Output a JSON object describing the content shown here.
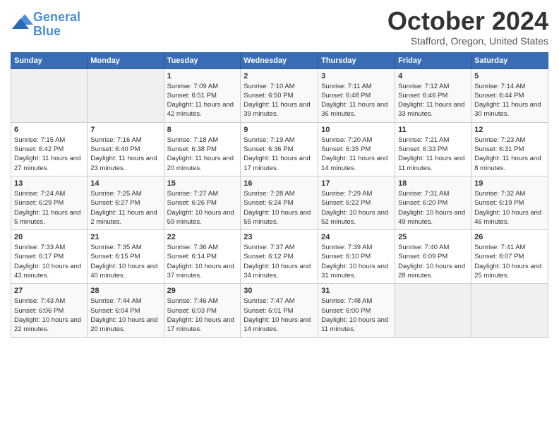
{
  "header": {
    "logo_line1": "General",
    "logo_line2": "Blue",
    "month_title": "October 2024",
    "location": "Stafford, Oregon, United States"
  },
  "weekdays": [
    "Sunday",
    "Monday",
    "Tuesday",
    "Wednesday",
    "Thursday",
    "Friday",
    "Saturday"
  ],
  "weeks": [
    [
      {
        "day": "",
        "sunrise": "",
        "sunset": "",
        "daylight": "",
        "empty": true
      },
      {
        "day": "",
        "sunrise": "",
        "sunset": "",
        "daylight": "",
        "empty": true
      },
      {
        "day": "1",
        "sunrise": "Sunrise: 7:09 AM",
        "sunset": "Sunset: 6:51 PM",
        "daylight": "Daylight: 11 hours and 42 minutes."
      },
      {
        "day": "2",
        "sunrise": "Sunrise: 7:10 AM",
        "sunset": "Sunset: 6:50 PM",
        "daylight": "Daylight: 11 hours and 39 minutes."
      },
      {
        "day": "3",
        "sunrise": "Sunrise: 7:11 AM",
        "sunset": "Sunset: 6:48 PM",
        "daylight": "Daylight: 11 hours and 36 minutes."
      },
      {
        "day": "4",
        "sunrise": "Sunrise: 7:12 AM",
        "sunset": "Sunset: 6:46 PM",
        "daylight": "Daylight: 11 hours and 33 minutes."
      },
      {
        "day": "5",
        "sunrise": "Sunrise: 7:14 AM",
        "sunset": "Sunset: 6:44 PM",
        "daylight": "Daylight: 11 hours and 30 minutes."
      }
    ],
    [
      {
        "day": "6",
        "sunrise": "Sunrise: 7:15 AM",
        "sunset": "Sunset: 6:42 PM",
        "daylight": "Daylight: 11 hours and 27 minutes."
      },
      {
        "day": "7",
        "sunrise": "Sunrise: 7:16 AM",
        "sunset": "Sunset: 6:40 PM",
        "daylight": "Daylight: 11 hours and 23 minutes."
      },
      {
        "day": "8",
        "sunrise": "Sunrise: 7:18 AM",
        "sunset": "Sunset: 6:38 PM",
        "daylight": "Daylight: 11 hours and 20 minutes."
      },
      {
        "day": "9",
        "sunrise": "Sunrise: 7:19 AM",
        "sunset": "Sunset: 6:36 PM",
        "daylight": "Daylight: 11 hours and 17 minutes."
      },
      {
        "day": "10",
        "sunrise": "Sunrise: 7:20 AM",
        "sunset": "Sunset: 6:35 PM",
        "daylight": "Daylight: 11 hours and 14 minutes."
      },
      {
        "day": "11",
        "sunrise": "Sunrise: 7:21 AM",
        "sunset": "Sunset: 6:33 PM",
        "daylight": "Daylight: 11 hours and 11 minutes."
      },
      {
        "day": "12",
        "sunrise": "Sunrise: 7:23 AM",
        "sunset": "Sunset: 6:31 PM",
        "daylight": "Daylight: 11 hours and 8 minutes."
      }
    ],
    [
      {
        "day": "13",
        "sunrise": "Sunrise: 7:24 AM",
        "sunset": "Sunset: 6:29 PM",
        "daylight": "Daylight: 11 hours and 5 minutes."
      },
      {
        "day": "14",
        "sunrise": "Sunrise: 7:25 AM",
        "sunset": "Sunset: 6:27 PM",
        "daylight": "Daylight: 11 hours and 2 minutes."
      },
      {
        "day": "15",
        "sunrise": "Sunrise: 7:27 AM",
        "sunset": "Sunset: 6:26 PM",
        "daylight": "Daylight: 10 hours and 59 minutes."
      },
      {
        "day": "16",
        "sunrise": "Sunrise: 7:28 AM",
        "sunset": "Sunset: 6:24 PM",
        "daylight": "Daylight: 10 hours and 55 minutes."
      },
      {
        "day": "17",
        "sunrise": "Sunrise: 7:29 AM",
        "sunset": "Sunset: 6:22 PM",
        "daylight": "Daylight: 10 hours and 52 minutes."
      },
      {
        "day": "18",
        "sunrise": "Sunrise: 7:31 AM",
        "sunset": "Sunset: 6:20 PM",
        "daylight": "Daylight: 10 hours and 49 minutes."
      },
      {
        "day": "19",
        "sunrise": "Sunrise: 7:32 AM",
        "sunset": "Sunset: 6:19 PM",
        "daylight": "Daylight: 10 hours and 46 minutes."
      }
    ],
    [
      {
        "day": "20",
        "sunrise": "Sunrise: 7:33 AM",
        "sunset": "Sunset: 6:17 PM",
        "daylight": "Daylight: 10 hours and 43 minutes."
      },
      {
        "day": "21",
        "sunrise": "Sunrise: 7:35 AM",
        "sunset": "Sunset: 6:15 PM",
        "daylight": "Daylight: 10 hours and 40 minutes."
      },
      {
        "day": "22",
        "sunrise": "Sunrise: 7:36 AM",
        "sunset": "Sunset: 6:14 PM",
        "daylight": "Daylight: 10 hours and 37 minutes."
      },
      {
        "day": "23",
        "sunrise": "Sunrise: 7:37 AM",
        "sunset": "Sunset: 6:12 PM",
        "daylight": "Daylight: 10 hours and 34 minutes."
      },
      {
        "day": "24",
        "sunrise": "Sunrise: 7:39 AM",
        "sunset": "Sunset: 6:10 PM",
        "daylight": "Daylight: 10 hours and 31 minutes."
      },
      {
        "day": "25",
        "sunrise": "Sunrise: 7:40 AM",
        "sunset": "Sunset: 6:09 PM",
        "daylight": "Daylight: 10 hours and 28 minutes."
      },
      {
        "day": "26",
        "sunrise": "Sunrise: 7:41 AM",
        "sunset": "Sunset: 6:07 PM",
        "daylight": "Daylight: 10 hours and 25 minutes."
      }
    ],
    [
      {
        "day": "27",
        "sunrise": "Sunrise: 7:43 AM",
        "sunset": "Sunset: 6:06 PM",
        "daylight": "Daylight: 10 hours and 22 minutes."
      },
      {
        "day": "28",
        "sunrise": "Sunrise: 7:44 AM",
        "sunset": "Sunset: 6:04 PM",
        "daylight": "Daylight: 10 hours and 20 minutes."
      },
      {
        "day": "29",
        "sunrise": "Sunrise: 7:46 AM",
        "sunset": "Sunset: 6:03 PM",
        "daylight": "Daylight: 10 hours and 17 minutes."
      },
      {
        "day": "30",
        "sunrise": "Sunrise: 7:47 AM",
        "sunset": "Sunset: 6:01 PM",
        "daylight": "Daylight: 10 hours and 14 minutes."
      },
      {
        "day": "31",
        "sunrise": "Sunrise: 7:48 AM",
        "sunset": "Sunset: 6:00 PM",
        "daylight": "Daylight: 10 hours and 11 minutes."
      },
      {
        "day": "",
        "sunrise": "",
        "sunset": "",
        "daylight": "",
        "empty": true
      },
      {
        "day": "",
        "sunrise": "",
        "sunset": "",
        "daylight": "",
        "empty": true
      }
    ]
  ]
}
